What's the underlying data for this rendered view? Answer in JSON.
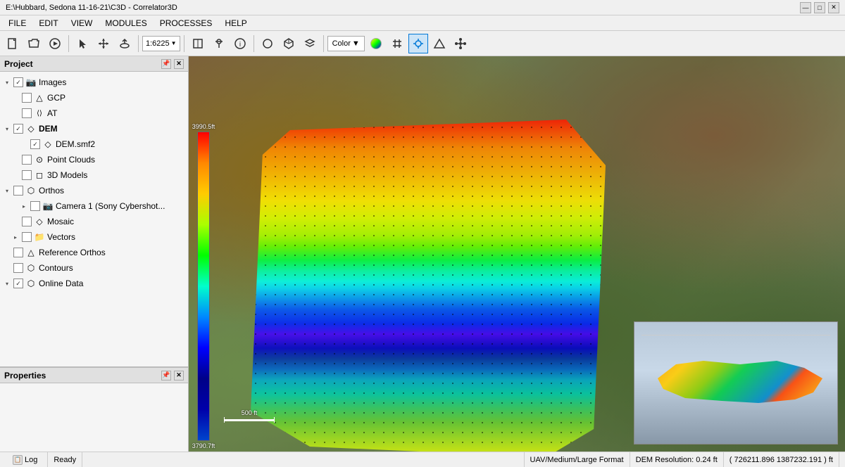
{
  "window": {
    "title": "E:\\Hubbard, Sedona 11-16-21\\C3D - Correlator3D",
    "controls": [
      "—",
      "□",
      "✕"
    ]
  },
  "menubar": {
    "items": [
      "FILE",
      "EDIT",
      "VIEW",
      "MODULES",
      "PROCESSES",
      "HELP"
    ]
  },
  "toolbar": {
    "scale": "1:6225",
    "color_label": "Color",
    "tools": [
      "new",
      "open",
      "play",
      "cursor",
      "pan",
      "rotate3d",
      "box",
      "polygon",
      "edit",
      "measure",
      "info",
      "circle",
      "cube",
      "layers",
      "colormap",
      "pointer",
      "target",
      "triangle",
      "network"
    ]
  },
  "project": {
    "title": "Project",
    "items": [
      {
        "id": "images",
        "label": "Images",
        "checked": true,
        "expanded": true,
        "indent": 0,
        "icon": "📷",
        "has_arrow": true
      },
      {
        "id": "gcp",
        "label": "GCP",
        "checked": false,
        "expanded": false,
        "indent": 1,
        "icon": "△",
        "has_arrow": false
      },
      {
        "id": "at",
        "label": "AT",
        "checked": false,
        "expanded": false,
        "indent": 1,
        "icon": "⟨⟩",
        "has_arrow": false
      },
      {
        "id": "dem",
        "label": "DEM",
        "checked": true,
        "expanded": true,
        "indent": 0,
        "icon": "◇",
        "has_arrow": true
      },
      {
        "id": "dem_smf2",
        "label": "DEM.smf2",
        "checked": true,
        "expanded": false,
        "indent": 2,
        "icon": "◇",
        "has_arrow": false
      },
      {
        "id": "point_clouds",
        "label": "Point Clouds",
        "checked": false,
        "expanded": false,
        "indent": 1,
        "icon": "⊙",
        "has_arrow": false
      },
      {
        "id": "3d_models",
        "label": "3D Models",
        "checked": false,
        "expanded": false,
        "indent": 1,
        "icon": "◻",
        "has_arrow": false
      },
      {
        "id": "orthos",
        "label": "Orthos",
        "checked": false,
        "expanded": true,
        "indent": 0,
        "icon": "⬡",
        "has_arrow": true
      },
      {
        "id": "camera1",
        "label": "Camera 1 (Sony Cybershot...",
        "checked": false,
        "expanded": false,
        "indent": 2,
        "icon": "📷",
        "has_arrow": true
      },
      {
        "id": "mosaic",
        "label": "Mosaic",
        "checked": false,
        "expanded": false,
        "indent": 1,
        "icon": "◇",
        "has_arrow": false
      },
      {
        "id": "vectors",
        "label": "Vectors",
        "checked": false,
        "expanded": false,
        "indent": 1,
        "icon": "📁",
        "has_arrow": true
      },
      {
        "id": "ref_orthos",
        "label": "Reference Orthos",
        "checked": false,
        "expanded": false,
        "indent": 0,
        "icon": "△",
        "has_arrow": false
      },
      {
        "id": "contours",
        "label": "Contours",
        "checked": false,
        "expanded": false,
        "indent": 0,
        "icon": "⬡",
        "has_arrow": false
      },
      {
        "id": "online_data",
        "label": "Online Data",
        "checked": true,
        "expanded": true,
        "indent": 0,
        "icon": "⬡",
        "has_arrow": true
      }
    ]
  },
  "properties": {
    "title": "Properties"
  },
  "colorscale": {
    "top_label": "3990.5ft",
    "bottom_label": "3790.7ft"
  },
  "map_scale": {
    "label": "500 ft"
  },
  "statusbar": {
    "log_label": "Log",
    "ready_label": "Ready",
    "format_label": "UAV/Medium/Large Format",
    "resolution_label": "DEM Resolution: 0.24 ft",
    "coords_label": "( 726211.896  1387232.191 ) ft"
  }
}
